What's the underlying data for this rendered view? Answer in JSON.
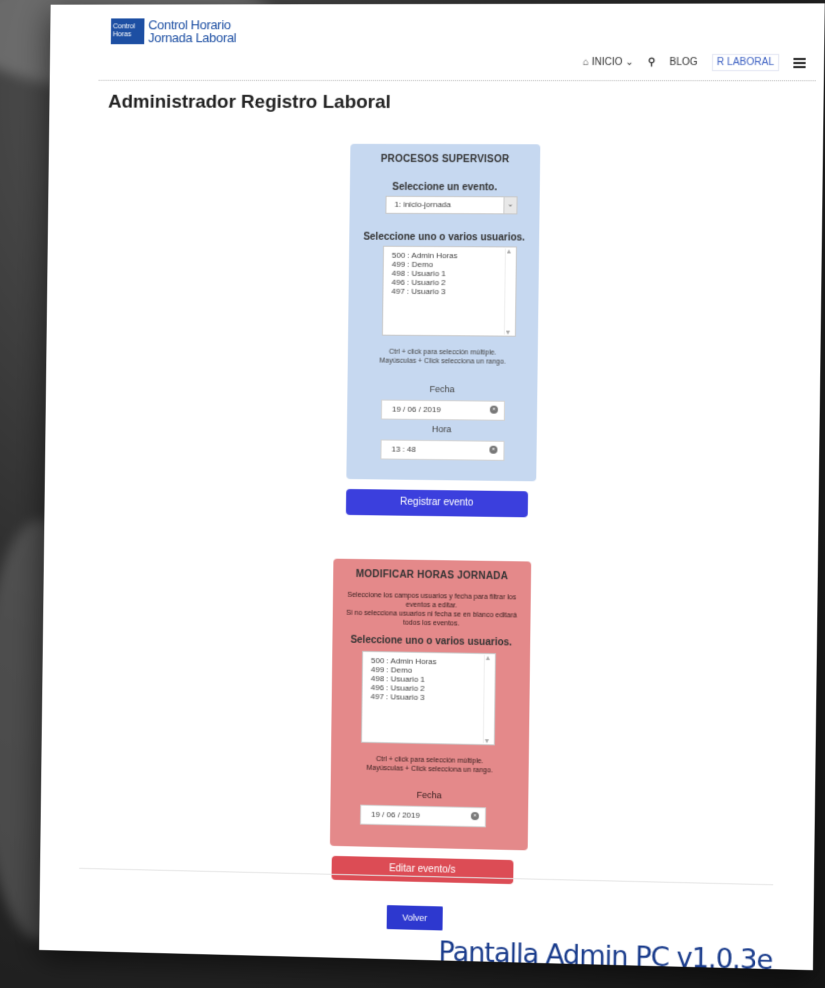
{
  "logo": {
    "icon_line1": "Control",
    "icon_line2": "Horas",
    "line1": "Control Horario",
    "line2": "Jornada Laboral"
  },
  "nav": {
    "inicio": "INICIO",
    "blog": "BLOG",
    "laboral": "R LABORAL",
    "home_icon": "home-icon",
    "search_icon": "search-icon",
    "menu_icon": "hamburger-icon"
  },
  "page_title": "Administrador Registro Laboral",
  "supervisor": {
    "title": "PROCESOS SUPERVISOR",
    "event_label": "Seleccione un evento.",
    "event_selected": "1: inicio-jornada",
    "users_label": "Seleccione uno o varios usuarios.",
    "users": [
      "500 : Admin Horas",
      "499 : Demo",
      "498 : Usuario 1",
      "496 : Usuario 2",
      "497 : Usuario 3"
    ],
    "hint_1": "Ctrl + click para selección múltiple.",
    "hint_2": "Mayúsculas + Click selecciona un rango.",
    "date_label": "Fecha",
    "date_value": "19 / 06 / 2019",
    "time_label": "Hora",
    "time_value": "13 : 48",
    "submit": "Registrar evento"
  },
  "modify": {
    "title": "MODIFICAR HORAS JORNADA",
    "intro_1": "Seleccione los campos usuarios y fecha para filtrar los eventos a editar.",
    "intro_2": "Si no selecciona usuarios ni fecha se en blanco editará todos los eventos.",
    "users_label": "Seleccione uno o varios usuarios.",
    "users": [
      "500 : Admin Horas",
      "499 : Demo",
      "498 : Usuario 1",
      "496 : Usuario 2",
      "497 : Usuario 3"
    ],
    "hint_1": "Ctrl + click para selección múltiple.",
    "hint_2": "Mayúsculas + Click selecciona un rango.",
    "date_label": "Fecha",
    "date_value": "19 / 06 / 2019",
    "submit": "Editar evento/s"
  },
  "back": "Volver",
  "version": "Pantalla Admin PC v1.0.3e"
}
